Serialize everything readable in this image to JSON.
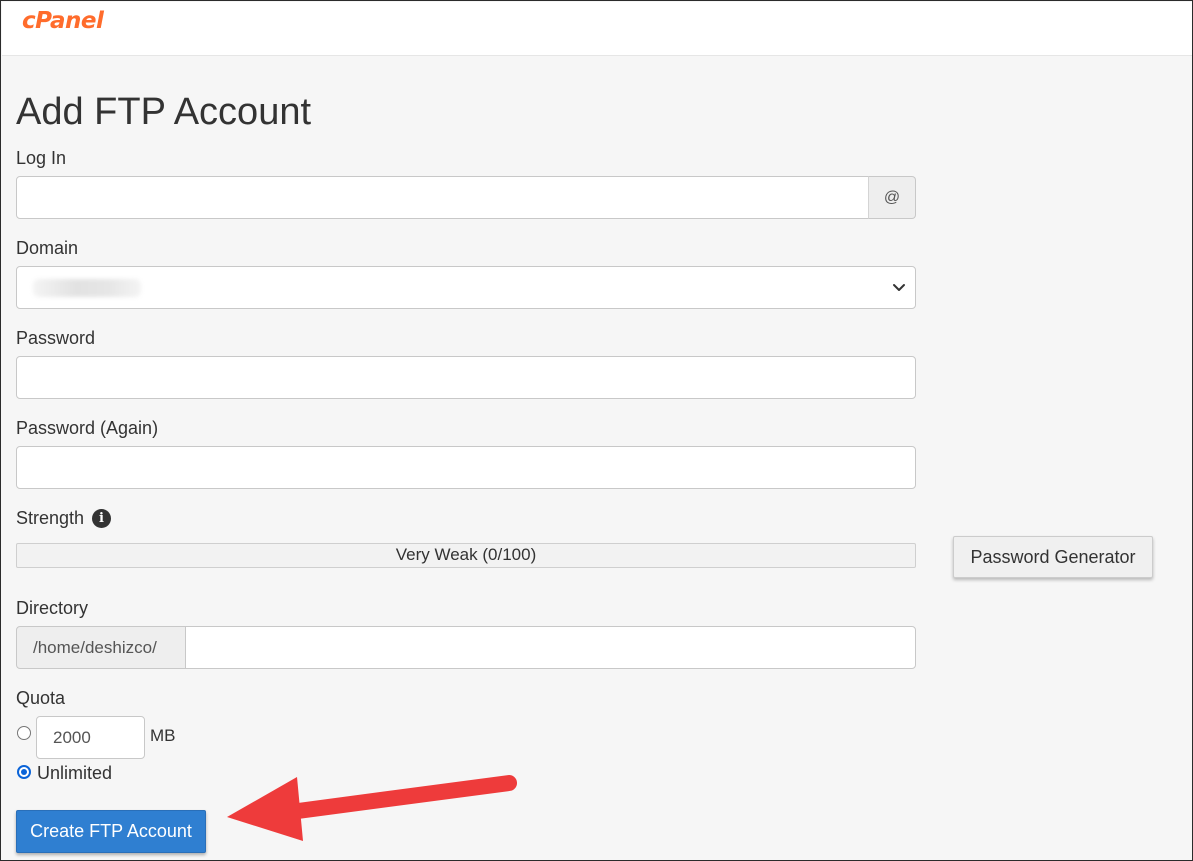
{
  "brand": {
    "logo_text": "cPanel",
    "logo_color": "#ff6c2c"
  },
  "page": {
    "title": "Add FTP Account"
  },
  "form": {
    "login": {
      "label": "Log In",
      "value": "",
      "addon": "@"
    },
    "domain": {
      "label": "Domain",
      "selected": ""
    },
    "password": {
      "label": "Password",
      "value": ""
    },
    "password_again": {
      "label": "Password (Again)",
      "value": ""
    },
    "strength": {
      "label": "Strength",
      "text": "Very Weak (0/100)",
      "score": 0,
      "info_icon": "info-circle-icon"
    },
    "password_generator_label": "Password Generator",
    "directory": {
      "label": "Directory",
      "prefix": "/home/deshizco/",
      "value": ""
    },
    "quota": {
      "label": "Quota",
      "limited_value": "2000",
      "unit": "MB",
      "unlimited_label": "Unlimited",
      "selected": "unlimited"
    },
    "submit_label": "Create FTP Account"
  },
  "colors": {
    "primary_button": "#2f7fd1",
    "annotation_arrow": "#ee3b3b"
  }
}
